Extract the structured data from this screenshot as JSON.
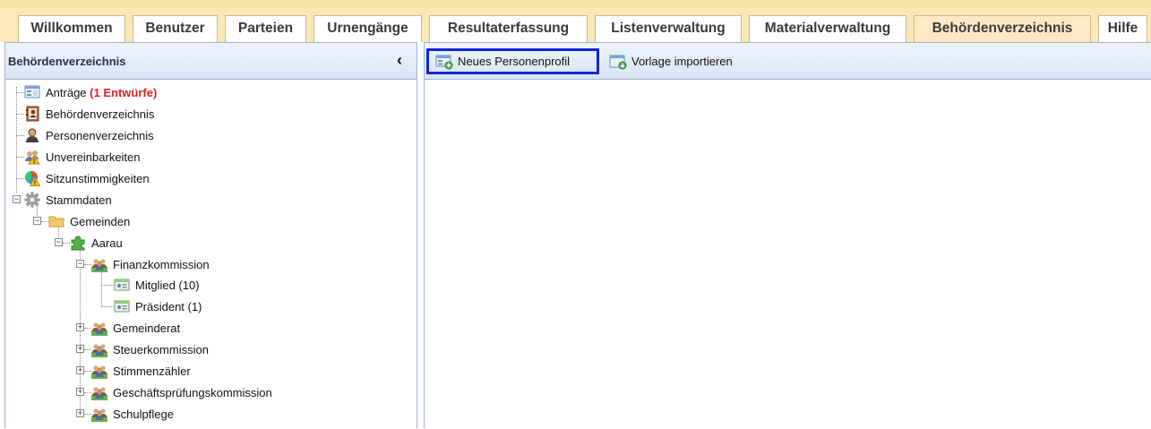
{
  "tabs": [
    "Willkommen",
    "Benutzer",
    "Parteien",
    "Urnengänge",
    "Resultaterfassung",
    "Listenverwaltung",
    "Materialverwaltung",
    "Behördenverzeichnis",
    "Hilfe"
  ],
  "active_tab": "Behördenverzeichnis",
  "left_panel": {
    "title": "Behördenverzeichnis",
    "collapse_icon": "chevron-left-icon",
    "tree": [
      {
        "label": "Anträge",
        "extra": "(1 Entwürfe)",
        "icon": "form-icon"
      },
      {
        "label": "Behördenverzeichnis",
        "icon": "address-book-icon"
      },
      {
        "label": "Personenverzeichnis",
        "icon": "person-icon"
      },
      {
        "label": "Unvereinbarkeiten",
        "icon": "warning-persons-icon"
      },
      {
        "label": "Sitzunstimmigkeiten",
        "icon": "pie-warning-icon"
      },
      {
        "label": "Stammdaten",
        "icon": "gear-icon",
        "expanded": true
      },
      {
        "label": "Gemeinden",
        "icon": "folder-icon",
        "expanded": true
      },
      {
        "label": "Aarau",
        "icon": "puzzle-icon",
        "expanded": true
      },
      {
        "label": "Finanzkommission",
        "icon": "group-icon",
        "expanded": true
      },
      {
        "label": "Mitglied (10)",
        "icon": "role-icon"
      },
      {
        "label": "Präsident (1)",
        "icon": "role-icon"
      },
      {
        "label": "Gemeinderat",
        "icon": "group-icon",
        "expanded": false
      },
      {
        "label": "Steuerkommission",
        "icon": "group-icon",
        "expanded": false
      },
      {
        "label": "Stimmenzähler",
        "icon": "group-icon",
        "expanded": false
      },
      {
        "label": "Geschäftsprüfungskommission",
        "icon": "group-icon",
        "expanded": false
      },
      {
        "label": "Schulpflege",
        "icon": "group-icon",
        "expanded": false
      }
    ]
  },
  "toolbar": {
    "new_profile": {
      "label": "Neues Personenprofil",
      "icon": "new-profile-icon"
    },
    "import_template": {
      "label": "Vorlage importieren",
      "icon": "import-icon"
    }
  },
  "colors": {
    "tabbar_bg": "#fbe8b6",
    "active_tab_bg": "#fbeac4",
    "panel_header": "#dce7f5",
    "focus_border": "#1027d6",
    "draft_red": "#e02020"
  }
}
